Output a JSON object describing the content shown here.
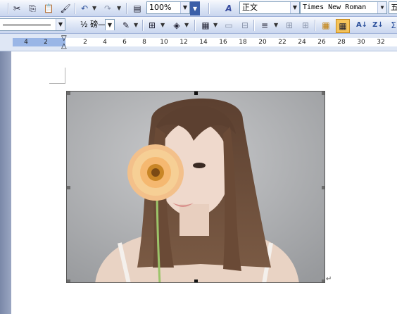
{
  "toolbar_top": {
    "zoom": "100%",
    "style": "正文",
    "font": "Times New Roman",
    "size_partial": "五",
    "colors": {
      "accent": "#3b5fa8",
      "highlight": "#f6c45a"
    }
  },
  "toolbar_bottom": {
    "border_style_dropdown_value": "",
    "line_weight": "½ 磅—"
  },
  "ruler": {
    "numbers": [
      "4",
      "2",
      "2",
      "4",
      "6",
      "8",
      "10",
      "12",
      "14",
      "16",
      "18",
      "20",
      "22",
      "24",
      "26",
      "28",
      "30",
      "32"
    ]
  },
  "document": {
    "picture": {
      "description_icon": "photo-image",
      "selected": true
    }
  }
}
